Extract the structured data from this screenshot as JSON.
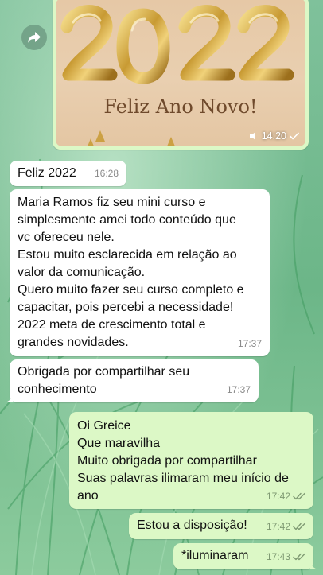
{
  "image_message": {
    "caption": "Feliz Ano Novo!",
    "year_art": "2022",
    "time": "14:20"
  },
  "messages": [
    {
      "direction": "in",
      "text": "Feliz 2022",
      "time": "16:28"
    },
    {
      "direction": "in",
      "text": "Maria Ramos fiz seu mini curso e\nsimplesmente amei todo conteúdo que\nvc ofereceu nele.\nEstou muito esclarecida em relação ao\nvalor da comunicação.\nQuero muito fazer seu curso completo e\ncapacitar, pois percebi a necessidade!\n2022 meta de crescimento total e\ngrandes novidades.",
      "time": "17:37"
    },
    {
      "direction": "in",
      "text": "Obrigada por compartilhar seu\nconhecimento",
      "time": "17:37"
    },
    {
      "direction": "out",
      "text": "Oi Greice\nQue maravilha\nMuito obrigada por compartilhar\nSuas palavras ilimaram meu início de\nano",
      "time": "17:42"
    },
    {
      "direction": "out",
      "text": "Estou a disposição!",
      "time": "17:42"
    },
    {
      "direction": "out",
      "text": "*iluminaram",
      "time": "17:43"
    }
  ],
  "icons": {
    "forward": "forward-icon",
    "audio": "speaker-icon",
    "sent": "single-check-icon",
    "read": "double-check-icon"
  },
  "colors": {
    "incoming_bubble": "#ffffff",
    "outgoing_bubble": "#dcf8c6",
    "read_check": "#7f9a73"
  }
}
